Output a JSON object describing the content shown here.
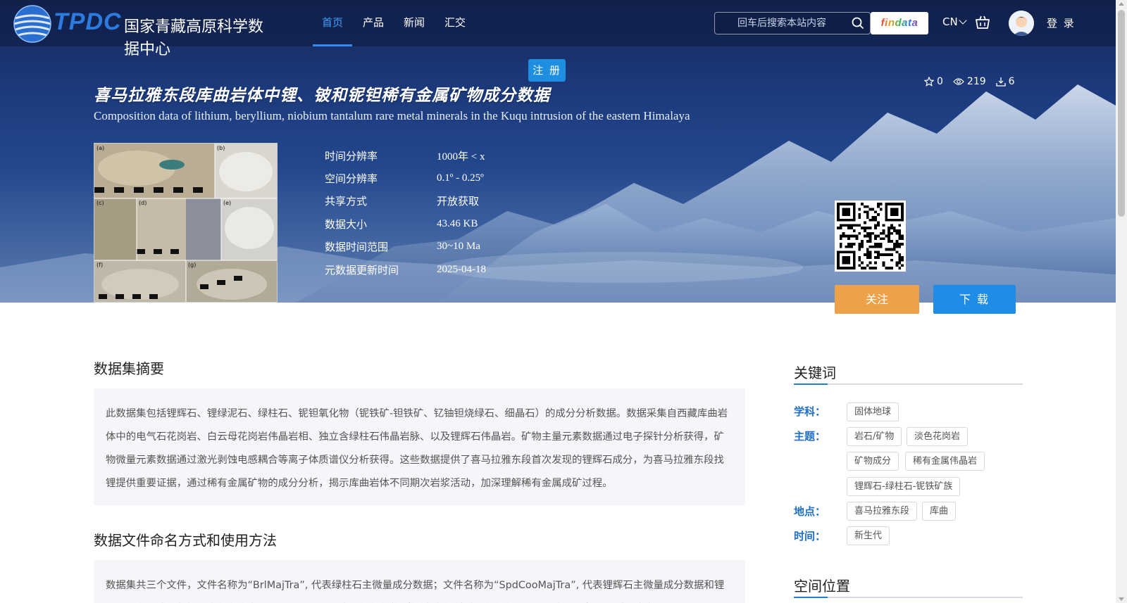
{
  "header": {
    "logo_text": "TPDC",
    "logo_cn": "国家青藏高原科学数据中心",
    "nav": [
      {
        "label": "首页",
        "active": true
      },
      {
        "label": "产品",
        "active": false
      },
      {
        "label": "新闻",
        "active": false
      },
      {
        "label": "汇交",
        "active": false
      }
    ],
    "search_placeholder": "回车后搜索本站内容",
    "findata_label": "findata",
    "lang_label": "CN",
    "login_label": "登 录",
    "register_label": "注 册",
    "icons": [
      "search-icon",
      "cart-icon",
      "user-avatar",
      "chevron-down-icon"
    ]
  },
  "dataset": {
    "title_cn": "喜马拉雅东段库曲岩体中锂、铍和铌钽稀有金属矿物成分数据",
    "title_en": "Composition data of lithium, beryllium, niobium tantalum rare metal minerals in the Kuqu intrusion of the eastern Himalaya",
    "stats": {
      "stars": "0",
      "views": "219",
      "downloads": "6"
    },
    "meta": [
      {
        "key": "时间分辨率",
        "value": "1000年 < x"
      },
      {
        "key": "空间分辨率",
        "value": "0.1º - 0.25º"
      },
      {
        "key": "共享方式",
        "value": "开放获取"
      },
      {
        "key": "数据大小",
        "value": "43.46 KB"
      },
      {
        "key": "数据时间范围",
        "value": "30~10 Ma"
      },
      {
        "key": "元数据更新时间",
        "value": "2025-04-18"
      }
    ],
    "follow_label": "关注",
    "download_label": "下 载",
    "thumb_panel_labels": [
      "(a)",
      "(b)",
      "(c)",
      "(d)",
      "(e)",
      "(f)",
      "(g)"
    ]
  },
  "abstract": {
    "heading": "数据集摘要",
    "text": "此数据集包括锂辉石、锂绿泥石、绿柱石、铌钽氧化物（铌铁矿-钽铁矿、钇铀钽烧绿石、细晶石）的成分分析数据。数据采集自西藏库曲岩体中的电气石花岗岩、白云母花岗岩伟晶岩相、独立含绿柱石伟晶岩脉、以及锂辉石伟晶岩。矿物主量元素数据通过电子探针分析获得，矿物微量元素数据通过激光剥蚀电感耦合等离子体质谱仪分析获得。这些数据提供了喜马拉雅东段首次发现的锂辉石成分，为喜马拉雅东段找锂提供重要证据，通过稀有金属矿物的成分分析，揭示库曲岩体不同期次岩浆活动，加深理解稀有金属成矿过程。"
  },
  "usage": {
    "heading": "数据文件命名方式和使用方法",
    "text": "数据集共三个文件，文件名称为“BrlMajTra”, 代表绿柱石主微量成分数据；文件名称为“SpdCooMajTra”, 代表锂辉石主微量成分数据和锂绿泥石主量成分数据；文件名称为“NTOMajTra”, 代表铌钽氧化物（铌铁矿-钽铁矿、钇铀钽烧绿石、细晶石）主量成分数据。"
  },
  "keywords": {
    "heading": "关键词",
    "groups": [
      {
        "label": "学科：",
        "tags": [
          "固体地球"
        ]
      },
      {
        "label": "主题：",
        "tags": [
          "岩石/矿物",
          "淡色花岗岩",
          "矿物成分",
          "稀有金属伟晶岩",
          "锂辉石-绿柱石-铌铁矿族"
        ]
      },
      {
        "label": "地点：",
        "tags": [
          "喜马拉雅东段",
          "库曲"
        ]
      },
      {
        "label": "时间：",
        "tags": [
          "新生代"
        ]
      }
    ]
  },
  "location": {
    "heading": "空间位置"
  },
  "colors": {
    "accent": "#1f8de6",
    "follow": "#eda24a",
    "nav_active": "#3aa0ff",
    "keyword_label": "#1f6fc8"
  }
}
